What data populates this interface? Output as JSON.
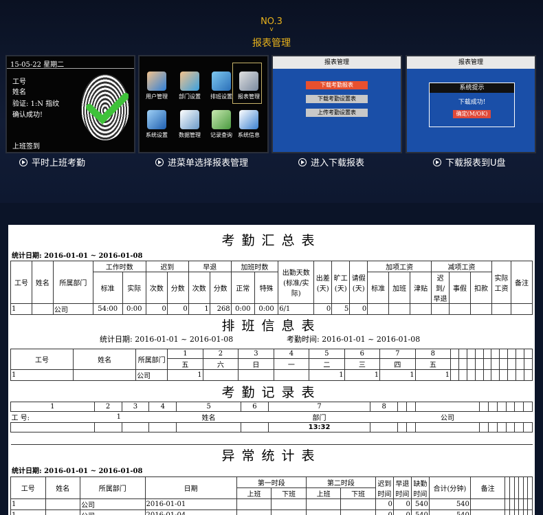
{
  "header": {
    "step": "NO.3",
    "arrow": "v",
    "title": "报表管理"
  },
  "panel1": {
    "datetime": "15-05-22  星期二",
    "lines": [
      "工号",
      "姓名",
      "验证: 1:N 指纹",
      "确认成功!"
    ],
    "footer": "上班签到"
  },
  "panel2": {
    "menu": [
      "用户管理",
      "部门设置",
      "排班设置",
      "报表管理",
      "系统设置",
      "数据管理",
      "记录查询",
      "系统信息"
    ]
  },
  "panel3": {
    "title": "报表管理",
    "buttons": [
      "下载考勤报表",
      "下载考勤设置表",
      "上传考勤设置表"
    ]
  },
  "panel4": {
    "title": "报表管理",
    "dialog_title": "系统提示",
    "message": "下载成功!",
    "ok": "确定(M/OK)"
  },
  "captions": [
    "平时上班考勤",
    "进菜单选择报表管理",
    "进入下载报表",
    "下载报表到U盘"
  ],
  "summary": {
    "title": "考勤汇总表",
    "period": "统计日期:  2016-01-01  ~  2016-01-08",
    "h1": [
      "工号",
      "姓名",
      "所属部门",
      "工作时数",
      "迟到",
      "早退",
      "加班时数",
      "出勤天数(标准/实际)",
      "出差(天)",
      "旷工(天)",
      "请假(天)",
      "加项工资",
      "减项工资",
      "实际工资",
      "备注"
    ],
    "h2": [
      "标准",
      "实际",
      "次数",
      "分数",
      "次数",
      "分数",
      "正常",
      "特殊",
      "标准",
      "加班",
      "津贴",
      "迟到/早退",
      "事假",
      "扣款"
    ],
    "row": [
      "1",
      "",
      "公司",
      "54:00",
      "0:00",
      "0",
      "0",
      "1",
      "268",
      "0:00",
      "0:00",
      "6/1",
      "0",
      "5",
      "0"
    ]
  },
  "schedule": {
    "title": "排班信息表",
    "period": "统计日期:  2016-01-01  ~  2016-01-08",
    "period2": "考勤时间: 2016-01-01  ~  2016-01-08",
    "h": [
      "工号",
      "姓名",
      "所属部门"
    ],
    "days": [
      "1",
      "2",
      "3",
      "4",
      "5",
      "6",
      "7",
      "8"
    ],
    "weekdays": [
      "五",
      "六",
      "日",
      "一",
      "二",
      "三",
      "四",
      "五"
    ],
    "row": [
      "1",
      "",
      "公司",
      "1",
      "",
      "",
      "",
      "1",
      "1",
      "1",
      "1"
    ]
  },
  "record": {
    "title": "考勤记录表",
    "days": [
      "1",
      "2",
      "3",
      "4",
      "5",
      "6",
      "7",
      "8"
    ],
    "labels": [
      "工 号:",
      "1",
      "姓名",
      "部门",
      "公司"
    ],
    "time": "13:32"
  },
  "abnormal": {
    "title": "异常统计表",
    "period": "统计日期:  2016-01-01  ~  2016-01-08",
    "h1": [
      "工号",
      "姓名",
      "所属部门",
      "日期",
      "第一时段",
      "第二时段",
      "迟到时间",
      "早退时间",
      "缺勤时间",
      "合计(分钟)",
      "备注"
    ],
    "h2": [
      "上班",
      "下班",
      "上班",
      "下班"
    ],
    "rows": [
      [
        "1",
        "",
        "公司",
        "2016-01-01",
        "",
        "",
        "",
        "",
        "0",
        "0",
        "540",
        "540"
      ],
      [
        "1",
        "",
        "公司",
        "2016-01-04",
        "",
        "",
        "",
        "",
        "0",
        "0",
        "540",
        "540"
      ]
    ]
  }
}
